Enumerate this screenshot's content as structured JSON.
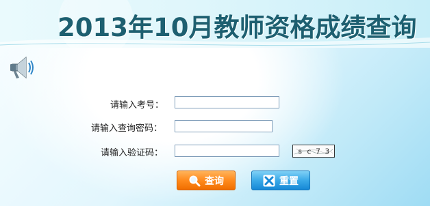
{
  "header": {
    "title": "2013年10月教师资格成绩查询"
  },
  "form": {
    "exam_label": "请输入考号：",
    "exam_value": "",
    "password_label": "请输入查询密码：",
    "password_value": "",
    "captcha_label": "请输入验证码：",
    "captcha_value": "",
    "captcha_text": "s c 7 3"
  },
  "buttons": {
    "query_label": "查询",
    "reset_label": "重置"
  },
  "icons": {
    "speaker": "speaker-icon",
    "query": "magnifier-icon",
    "reset": "close-x-icon"
  },
  "colors": {
    "title": "#1d5f70",
    "query_button": "#ff8a1c",
    "reset_button": "#3aa9e8"
  }
}
